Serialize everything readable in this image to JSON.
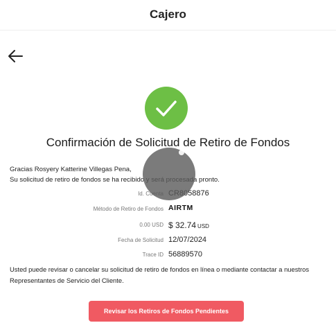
{
  "header": {
    "title": "Cajero"
  },
  "icons": {
    "back": "arrow-left-icon",
    "success": "checkmark-icon"
  },
  "colors": {
    "success": "#6dbf45",
    "action_button": "#f05a62"
  },
  "page_title": "Confirmación de Solicitud de Retiro de Fondos",
  "greeting": {
    "line1": "Gracias Rosyery Katterine Villegas Pena,",
    "line2": "Su solicitud de retiro de fondos se ha recibido y será procesada pronto."
  },
  "details": {
    "account": {
      "label": "Id. Cuenta",
      "value": "CR8058876"
    },
    "method": {
      "label": "Método de Retiro de Fondos",
      "value": "AIRTM"
    },
    "amount": {
      "label": "0.00 USD",
      "value": "$ 32.74",
      "currency": "USD"
    },
    "date": {
      "label": "Fecha de Solicitud",
      "value": "12/07/2024"
    },
    "trace": {
      "label": "Trace ID",
      "value": "56889570"
    }
  },
  "notice": "Usted puede revisar o cancelar su solicitud de retiro de fondos en línea o mediante contactar a nuestros Representantes de Servicio del Cliente.",
  "action_button": {
    "label": "Revisar los Retiros de Fondos Pendientes"
  }
}
